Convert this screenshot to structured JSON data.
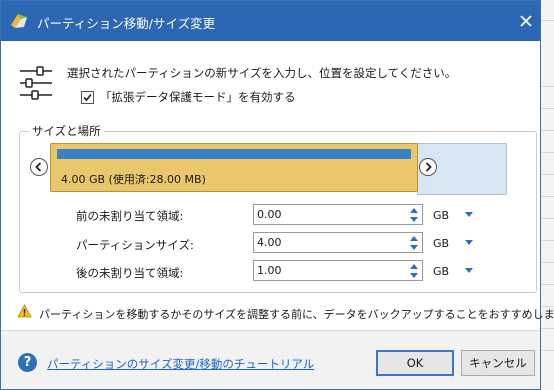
{
  "window": {
    "title": "パーティション移動/サイズ変更"
  },
  "header": {
    "instruction": "選択されたパーティションの新サイズを入力し、位置を設定してください。",
    "checkbox_label": "「拡張データ保護モード」を有効する",
    "checkbox_checked": true
  },
  "size_location": {
    "group_title": "サイズと場所",
    "partition_label": "4.00 GB (使用済:28.00 MB)",
    "used_fraction": 0.98
  },
  "fields": [
    {
      "label": "前の未割り当て領域:",
      "value": "0.00",
      "unit": "GB"
    },
    {
      "label": "パーティションサイズ:",
      "value": "4.00",
      "unit": "GB"
    },
    {
      "label": "後の未割り当て領域:",
      "value": "1.00",
      "unit": "GB"
    }
  ],
  "warning": "パーティションを移動するかそのサイズを調整する前に、データをバックアップすることをおすすめします。",
  "footer": {
    "help_link": "パーティションのサイズ変更/移動のチュートリアル",
    "ok_label": "OK",
    "cancel_label": "キャンセル"
  },
  "colors": {
    "titlebar": "#2b67b3",
    "partition_fill": "#e9c76a",
    "used_bar": "#3a82c8",
    "unallocated": "#d6e6f2",
    "link": "#1e63c6"
  }
}
